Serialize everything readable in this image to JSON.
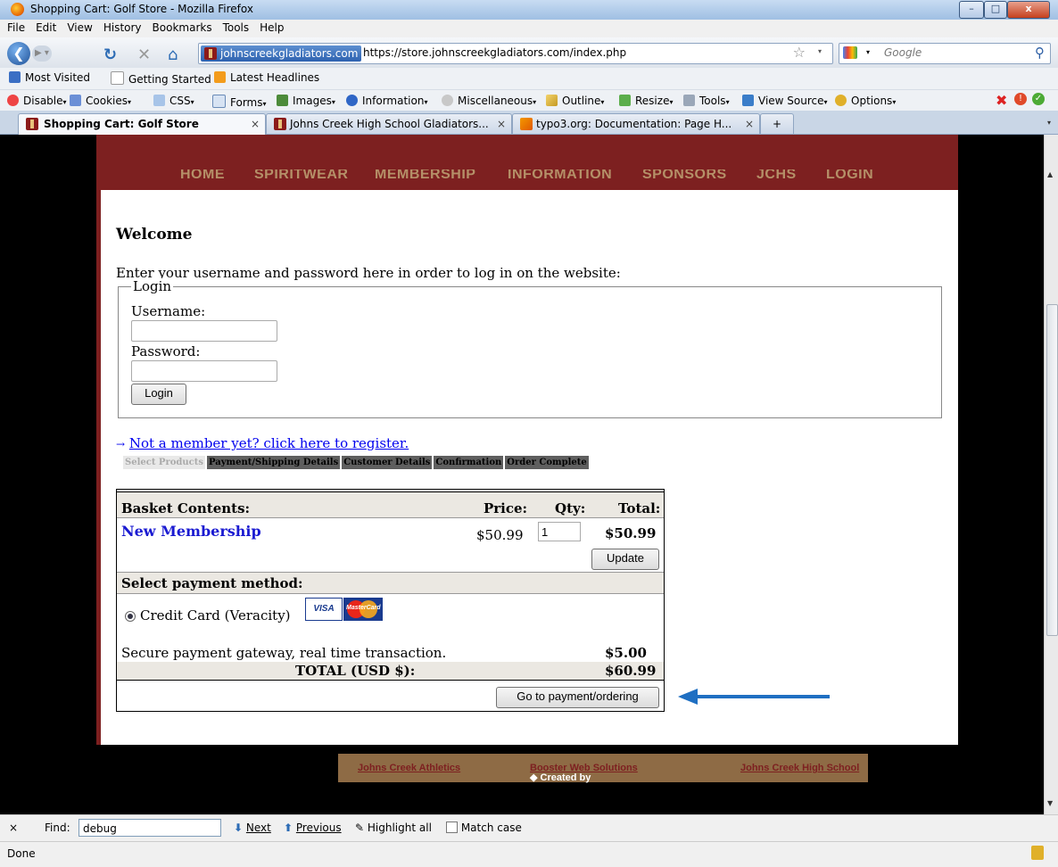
{
  "window": {
    "title": "Shopping Cart: Golf Store - Mozilla Firefox",
    "min": "–",
    "max": "□",
    "close": "x"
  },
  "menu": [
    "File",
    "Edit",
    "View",
    "History",
    "Bookmarks",
    "Tools",
    "Help"
  ],
  "nav": {
    "site_identity": "johnscreekgladiators.com",
    "url": "https://store.johnscreekgladiators.com/index.php",
    "search_placeholder": "Google"
  },
  "bookmarks": [
    "Most Visited",
    "Getting Started",
    "Latest Headlines"
  ],
  "devtools": [
    "Disable",
    "Cookies",
    "CSS",
    "Forms",
    "Images",
    "Information",
    "Miscellaneous",
    "Outline",
    "Resize",
    "Tools",
    "View Source",
    "Options"
  ],
  "tabs": [
    {
      "label": "Shopping Cart: Golf Store"
    },
    {
      "label": "Johns Creek High School Gladiators..."
    },
    {
      "label": "typo3.org: Documentation: Page H..."
    }
  ],
  "site_nav": [
    "HOME",
    "SPIRITWEAR",
    "MEMBERSHIP",
    "INFORMATION",
    "SPONSORS",
    "JCHS",
    "LOGIN"
  ],
  "page": {
    "heading": "Welcome",
    "intro": "Enter your username and password here in order to log in on the website:",
    "login": {
      "legend": "Login",
      "username_label": "Username:",
      "password_label": "Password:",
      "button": "Login"
    },
    "register_arrow": "→",
    "register_link": "Not a member yet? click here to register.",
    "steps": [
      "Select Products",
      "Payment/Shipping Details",
      "Customer Details",
      "Confirmation",
      "Order Complete"
    ]
  },
  "basket": {
    "header": {
      "contents": "Basket Contents:",
      "price": "Price:",
      "qty": "Qty:",
      "total": "Total:"
    },
    "item": {
      "name": "New Membership",
      "price": "$50.99",
      "qty": "1",
      "total": "$50.99"
    },
    "update": "Update",
    "payment_header": "Select payment method:",
    "payment_option": "Credit Card (Veracity)",
    "card_visa": "VISA",
    "card_mc": "MasterCard",
    "gateway_text": "Secure payment gateway, real time transaction.",
    "gateway_fee": "$5.00",
    "total_label": "TOTAL (USD $):",
    "total_value": "$60.99",
    "submit": "Go to payment/ordering"
  },
  "footer": {
    "left": "Johns Creek Athletics",
    "middle_prefix": "◆ Created by",
    "middle_link": "Booster Web Solutions",
    "right": "Johns Creek High School"
  },
  "findbar": {
    "close": "×",
    "label": "Find:",
    "value": "debug",
    "next": "Next",
    "previous": "Previous",
    "highlight": "Highlight all",
    "match_case": "Match case"
  },
  "status": "Done",
  "colors": {
    "maroon": "#7d2020",
    "footer_brown": "#8e6b45",
    "arrow_blue": "#1f6fc2",
    "link_blue": "#0000ee"
  }
}
